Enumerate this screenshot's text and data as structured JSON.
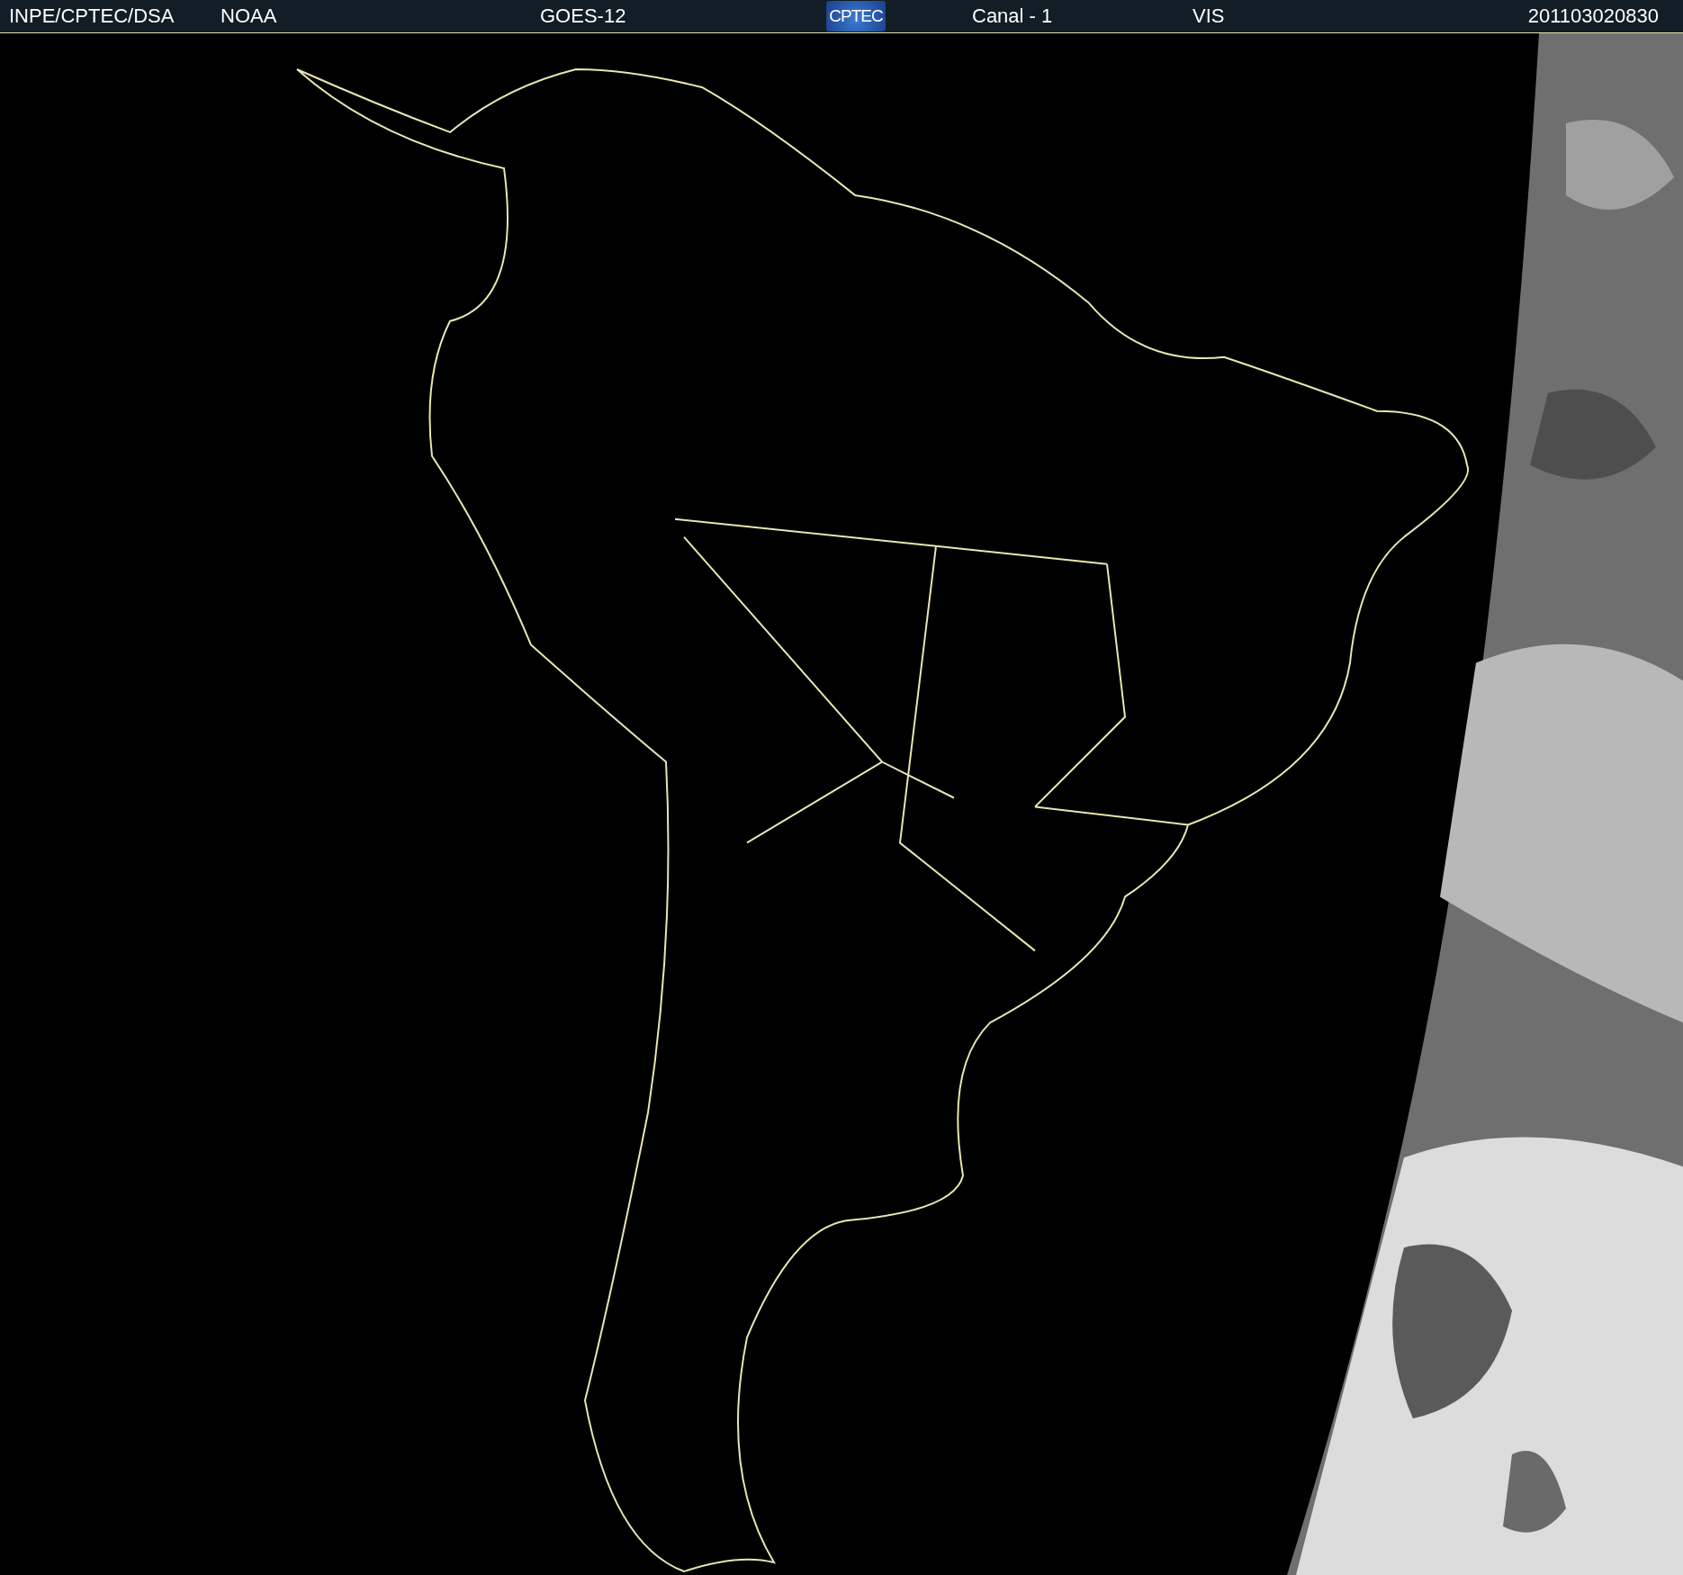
{
  "header": {
    "items": [
      {
        "kind": "text",
        "text": "INPE/CPTEC/DSA"
      },
      {
        "kind": "text",
        "text": "NOAA"
      },
      {
        "kind": "text",
        "text": "GOES-12"
      },
      {
        "kind": "logo",
        "text": "CPTEC"
      },
      {
        "kind": "text",
        "text": "Canal - 1"
      },
      {
        "kind": "text",
        "text": "VIS"
      },
      {
        "kind": "text",
        "text": "201103020830"
      }
    ]
  }
}
